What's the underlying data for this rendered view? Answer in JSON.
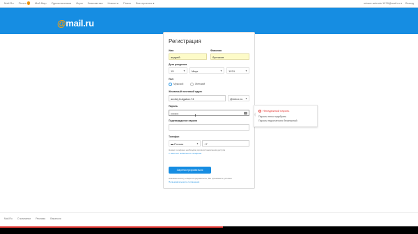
{
  "topbar": {
    "nav": [
      "Mail.Ru",
      "Почта",
      "Мой Мир",
      "Одноклассники",
      "Игры",
      "Знакомства",
      "Новости",
      "Поиск",
      "Все проекты ▾"
    ],
    "badge": "1",
    "account": [
      "mixaer.artemis.1978@mail.ru ▾",
      "Выход"
    ]
  },
  "logo": {
    "at": "@",
    "text": "mail.ru"
  },
  "form": {
    "title": "Регистрация",
    "first_name": {
      "label": "Имя",
      "value": "андрей"
    },
    "last_name": {
      "label": "Фамилия",
      "value": "булгаков"
    },
    "birth": {
      "label": "Дата рождения",
      "day": "15",
      "month": "Март",
      "year": "1974"
    },
    "gender": {
      "label": "Пол",
      "male": "Мужской",
      "female": "Женский"
    },
    "email": {
      "label": "Желаемый почтовый адрес",
      "value": "andrej.bulgakov.74",
      "domain": "@inbox.ru"
    },
    "password": {
      "label": "Пароль",
      "value": "••••••••"
    },
    "confirm": {
      "label": "Подтверждение пароля",
      "value": ""
    },
    "phone": {
      "label": "Телефон",
      "country": "Россия",
      "code": "+7",
      "hint": "Номер телефона необходим для восстановления доступа",
      "link": "У меня нет мобильного телефона"
    },
    "submit": "Зарегистрироваться",
    "terms_text": "Нажимая кнопку «Зарегистрироваться», Вы принимаете условия",
    "terms_link": "Пользовательского соглашения"
  },
  "popover": {
    "title": "Ненадежный пароль",
    "line1": "Пароль легко подобрать",
    "line2": "Пароль недостаточно безопасный"
  },
  "footer": {
    "links": [
      "Mail.Ru",
      "О компании",
      "Реклама",
      "Вакансии"
    ]
  },
  "colors": {
    "accent": "#168de2",
    "logo_at": "#ff9e00",
    "warning": "#e53935",
    "filled": "#fdfbc8"
  },
  "icons": [
    "eye-icon",
    "chevron-down-icon",
    "warning-icon",
    "flag-ru-icon"
  ]
}
